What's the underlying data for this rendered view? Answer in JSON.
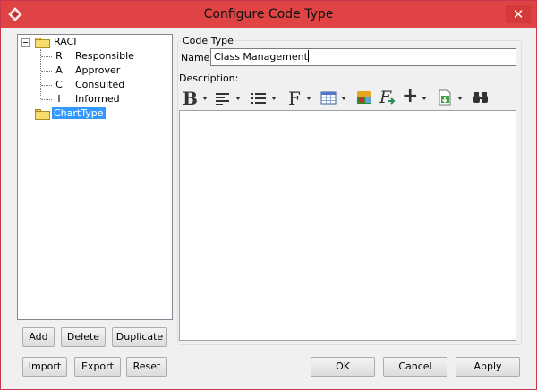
{
  "window": {
    "title": "Configure Code Type",
    "close_glyph": "✕"
  },
  "colors": {
    "titlebar": "#e04343",
    "selection": "#3399ff"
  },
  "tree": {
    "root": {
      "label": "RACI",
      "children": [
        {
          "code": "R",
          "label": "Responsible"
        },
        {
          "code": "A",
          "label": "Approver"
        },
        {
          "code": "C",
          "label": "Consulted"
        },
        {
          "code": "I",
          "label": "Informed"
        }
      ]
    },
    "second": {
      "label": "ChartType",
      "selected": true
    }
  },
  "buttons": {
    "add": "Add",
    "delete": "Delete",
    "duplicate": "Duplicate",
    "import": "Import",
    "export": "Export",
    "reset": "Reset",
    "ok": "OK",
    "cancel": "Cancel",
    "apply": "Apply"
  },
  "code_type": {
    "group_label": "Code Type",
    "name_label": "Name:",
    "name_value": "Class Management",
    "description_label": "Description:",
    "description_value": ""
  },
  "toolbar": {
    "bold_glyph": "B",
    "font_glyph": "F",
    "formula_glyph": "F",
    "insert_glyph": "+",
    "icons": [
      "bold-icon",
      "align-icon",
      "list-icon",
      "font-icon",
      "table-icon",
      "image-icon",
      "formula-icon",
      "insert-icon",
      "attachment-icon",
      "find-icon"
    ]
  }
}
